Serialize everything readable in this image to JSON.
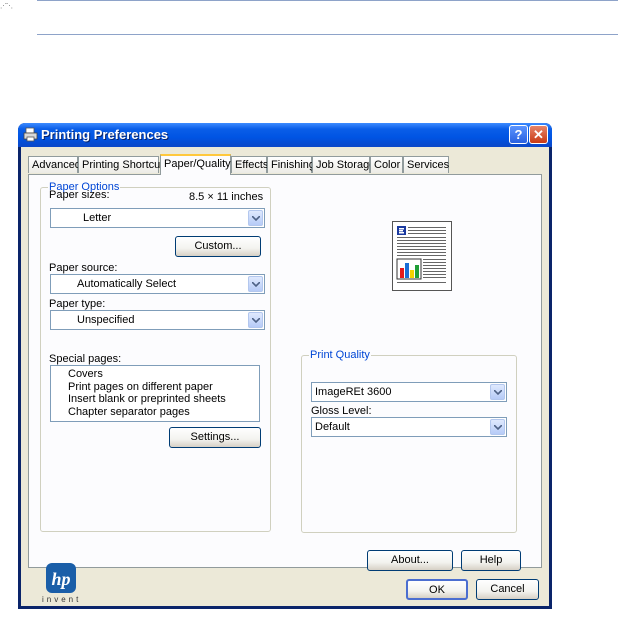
{
  "dialog": {
    "title": "Printing Preferences",
    "help_button": "?",
    "close_button": "✕"
  },
  "tabs": [
    {
      "label": "Advanced"
    },
    {
      "label": "Printing Shortcuts"
    },
    {
      "label": "Paper/Quality",
      "active": true
    },
    {
      "label": "Effects"
    },
    {
      "label": "Finishing"
    },
    {
      "label": "Job Storage"
    },
    {
      "label": "Color"
    },
    {
      "label": "Services"
    }
  ],
  "paper_options": {
    "group_label": "Paper Options",
    "paper_sizes_label": "Paper sizes:",
    "paper_size_dims": "8.5 × 11 inches",
    "paper_size_value": "Letter",
    "custom_button": "Custom...",
    "paper_source_label": "Paper source:",
    "paper_source_value": "Automatically Select",
    "paper_type_label": "Paper type:",
    "paper_type_value": "Unspecified",
    "special_pages_label": "Special pages:",
    "special_pages": [
      "Covers",
      "Print pages on different paper",
      "Insert blank or preprinted sheets",
      "Chapter separator pages"
    ],
    "settings_button": "Settings..."
  },
  "print_quality": {
    "group_label": "Print Quality",
    "quality_value": "ImageREt 3600",
    "gloss_label": "Gloss Level:",
    "gloss_value": "Default"
  },
  "logo": {
    "text": "invent"
  },
  "buttons": {
    "about": "About...",
    "help": "Help",
    "ok": "OK",
    "cancel": "Cancel"
  },
  "colors": {
    "titlebar": "#0054e3",
    "group_label": "#0046d5",
    "hp_blue": "#1a5ea8"
  }
}
